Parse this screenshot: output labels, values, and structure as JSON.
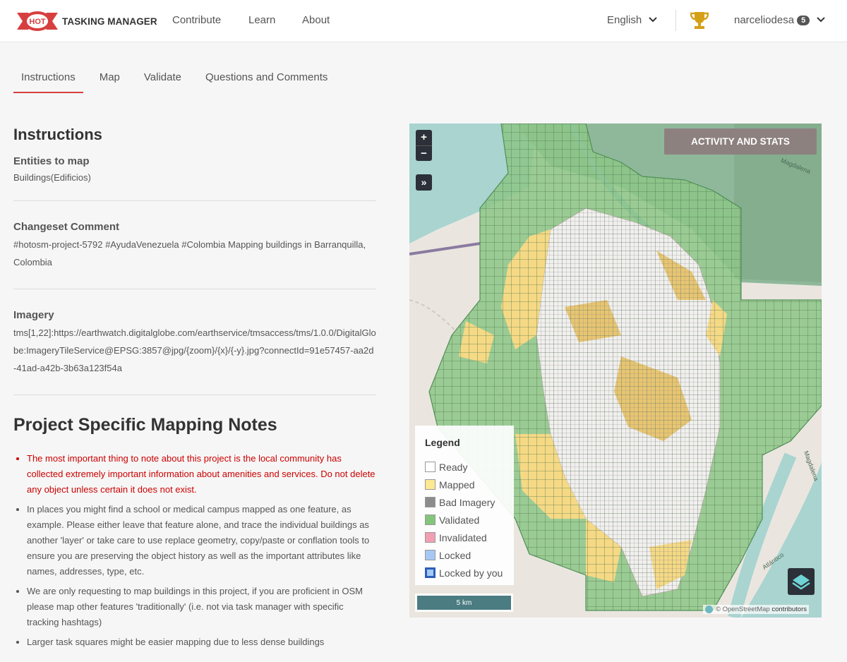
{
  "header": {
    "logo_text": "TASKING MANAGER",
    "logo_badge": "HOT",
    "nav": [
      "Contribute",
      "Learn",
      "About"
    ],
    "language": "English",
    "username": "narceliodesa",
    "user_level": "5",
    "icons": [
      "trophy-icon",
      "chevron-down-icon"
    ]
  },
  "tabs": [
    "Instructions",
    "Map",
    "Validate",
    "Questions and Comments"
  ],
  "active_tab": "Instructions",
  "instructions": {
    "heading": "Instructions",
    "entities_title": "Entities to map",
    "entities_value": "Buildings(Edificios)",
    "changeset_title": "Changeset Comment",
    "changeset_value": "#hotosm-project-5792 #AyudaVenezuela #Colombia Mapping buildings in Barranquilla, Colombia",
    "imagery_title": "Imagery",
    "imagery_value": "tms[1,22]:https://earthwatch.digitalglobe.com/earthservice/tmsaccess/tms/1.0.0/DigitalGlobe:ImageryTileService@EPSG:3857@jpg/{zoom}/{x}/{-y}.jpg?connectId=91e57457-aa2d-41ad-a42b-3b63a123f54a"
  },
  "notes": {
    "heading": "Project Specific Mapping Notes",
    "items": [
      "The most important thing to note about this project is the local community has collected extremely important information about amenities and services. Do not delete any object unless certain it does not exist.",
      "In places you might find a school or medical campus mapped as one feature, as example. Please either leave that feature alone, and trace the individual buildings as another 'layer' or take care to use replace geometry, copy/paste or conflation tools to ensure you are preserving the object history as well as the important attributes like names, addresses, type, etc.",
      "We are only requesting to map buildings in this project, if you are proficient in OSM please map other features 'traditionally' (i.e. not via task manager with specific tracking hashtags)",
      "Larger task squares might be easier mapping due to less dense buildings"
    ]
  },
  "map": {
    "zoom_in": "+",
    "zoom_out": "−",
    "expand": "»",
    "stats_button": "ACTIVITY AND STATS",
    "legend_title": "Legend",
    "legend": [
      {
        "label": "Ready",
        "color": "#ffffff"
      },
      {
        "label": "Mapped",
        "color": "#fde992"
      },
      {
        "label": "Bad Imagery",
        "color": "#8c8c8c"
      },
      {
        "label": "Validated",
        "color": "#83c67b"
      },
      {
        "label": "Invalidated",
        "color": "#f29fb4"
      },
      {
        "label": "Locked",
        "color": "#a5c8f5"
      },
      {
        "label": "Locked by you",
        "color": "#3b82e0"
      }
    ],
    "scale": "5 km",
    "attribution_prefix": "© OpenStreetMap",
    "attribution_suffix": "contributors",
    "labels": {
      "river_magdalena_top": "Magdalena",
      "river_magdalena_right": "Magdalena",
      "atlantico": "Atlántico"
    }
  },
  "colors": {
    "accent": "#d73f3f",
    "warn_text": "#cc0000",
    "validated": "#83c67b",
    "mapped": "#fde992",
    "stats_button": "#8d8180"
  }
}
